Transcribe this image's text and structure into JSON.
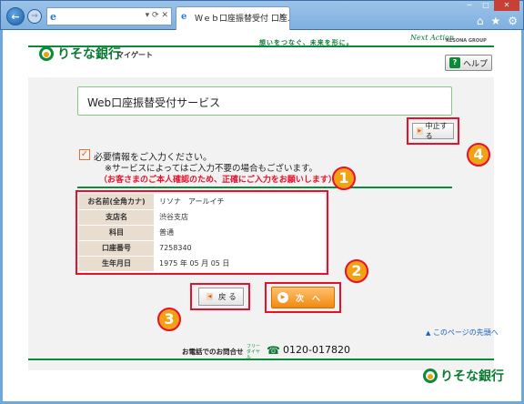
{
  "browser": {
    "tab_title": "Ｗｅｂ口座振替受付 口座...",
    "tab_close": "×",
    "address_controls": "▾ ⟳ ✕",
    "ie_glyph": "e"
  },
  "header": {
    "logo_text": "りそな銀行",
    "logo_sub": "マイゲート",
    "slogan": "想いをつなぐ、未来を形に。",
    "slogan_en": "Next Action",
    "group": "RESONA GROUP",
    "help_label": "ヘルプ",
    "help_glyph": "?"
  },
  "main": {
    "title": "Web口座振替受付サービス",
    "cancel_label": "中止する",
    "notice_line1": "必要情報をご入力ください。",
    "notice_line2": "※サービスによってはご入力不要の場合もございます。",
    "notice_line3": "（お客さまのご本人確認のため、正確にご入力をお願いします）",
    "table": [
      {
        "label": "お名前(全角カナ)",
        "value": "リソナ　アールイチ"
      },
      {
        "label": "支店名",
        "value": "渋谷支店"
      },
      {
        "label": "科目",
        "value": "普通"
      },
      {
        "label": "口座番号",
        "value": "7258340"
      },
      {
        "label": "生年月日",
        "value": "1975 年 05 月 05 日"
      }
    ],
    "back_label": "戻 る",
    "next_label": "次　へ",
    "top_link": "このページの先頭へ"
  },
  "annotations": {
    "badge1": "1",
    "badge2": "2",
    "badge3": "3",
    "badge4": "4"
  },
  "footer": {
    "phone_label": "お電話でのお問合せ",
    "free_dial": "フリーダイヤル",
    "phone_number": "0120-017820",
    "logo_text": "りそな銀行"
  },
  "colors": {
    "brand_green": "#0a8a3a",
    "highlight_red": "#e8102a",
    "badge_orange": "#f2a014",
    "next_orange": "#f08a10"
  }
}
